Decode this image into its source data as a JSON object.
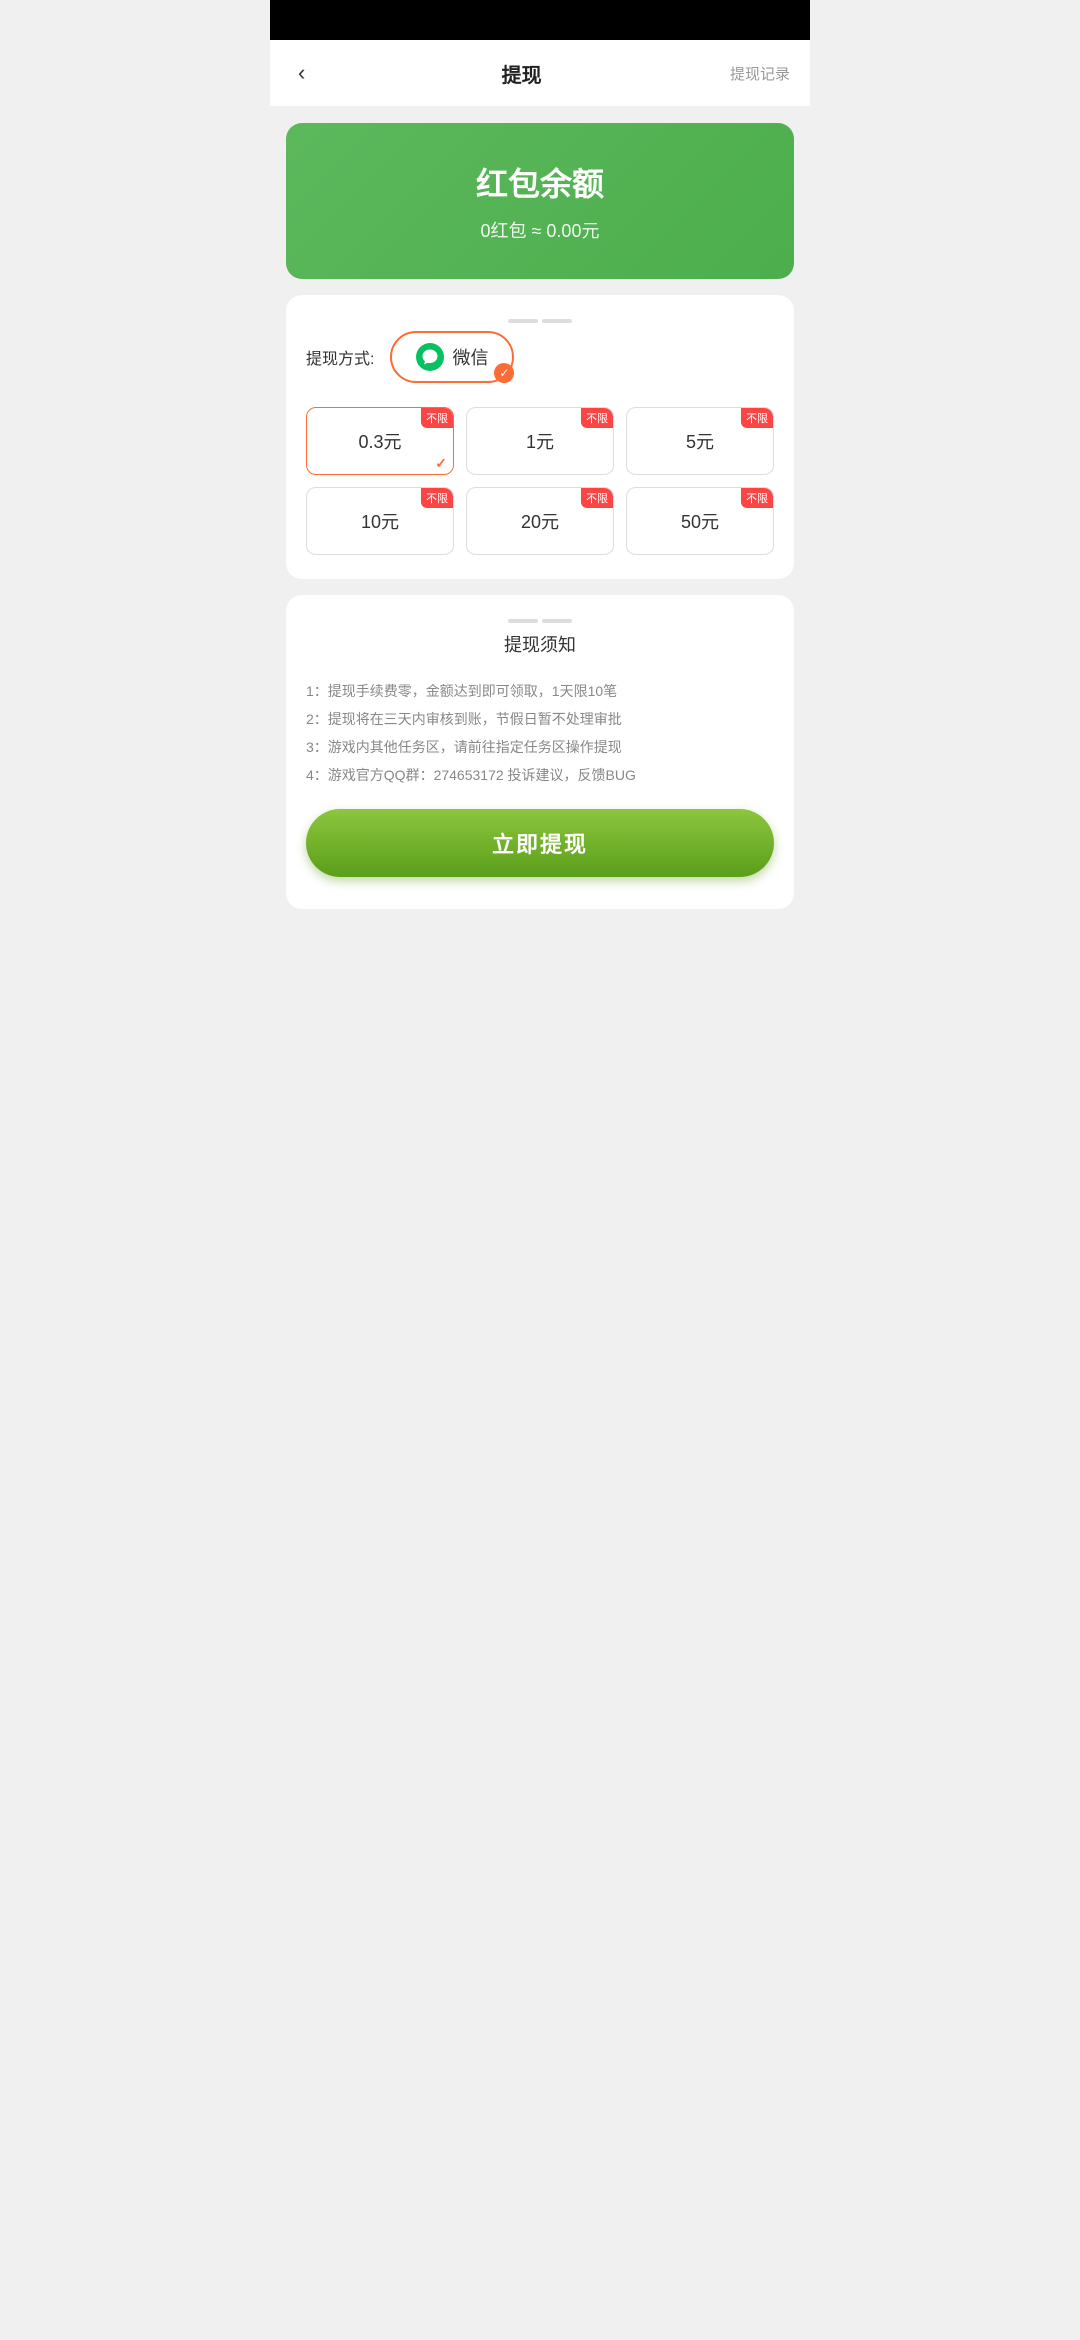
{
  "statusBar": {},
  "header": {
    "backLabel": "‹",
    "title": "提现",
    "recordLabel": "提现记录"
  },
  "greenCard": {
    "title": "红包余额",
    "subtitle": "0红包 ≈ 0.00元"
  },
  "withdrawMethod": {
    "label": "提现方式:",
    "wechatLabel": "微信"
  },
  "amounts": [
    {
      "value": "0.3元",
      "badge": "不限",
      "selected": true
    },
    {
      "value": "1元",
      "badge": "不限",
      "selected": false
    },
    {
      "value": "5元",
      "badge": "不限",
      "selected": false
    },
    {
      "value": "10元",
      "badge": "不限",
      "selected": false
    },
    {
      "value": "20元",
      "badge": "不限",
      "selected": false
    },
    {
      "value": "50元",
      "badge": "不限",
      "selected": false
    }
  ],
  "notice": {
    "title": "提现须知",
    "items": [
      "1：提现手续费零，金额达到即可领取，1天限10笔",
      "2：提现将在三天内审核到账，节假日暂不处理审批",
      "3：游戏内其他任务区，请前往指定任务区操作提现",
      "4：游戏官方QQ群：274653172 投诉建议，反馈BUG"
    ]
  },
  "submitButton": {
    "label": "立即提现"
  }
}
